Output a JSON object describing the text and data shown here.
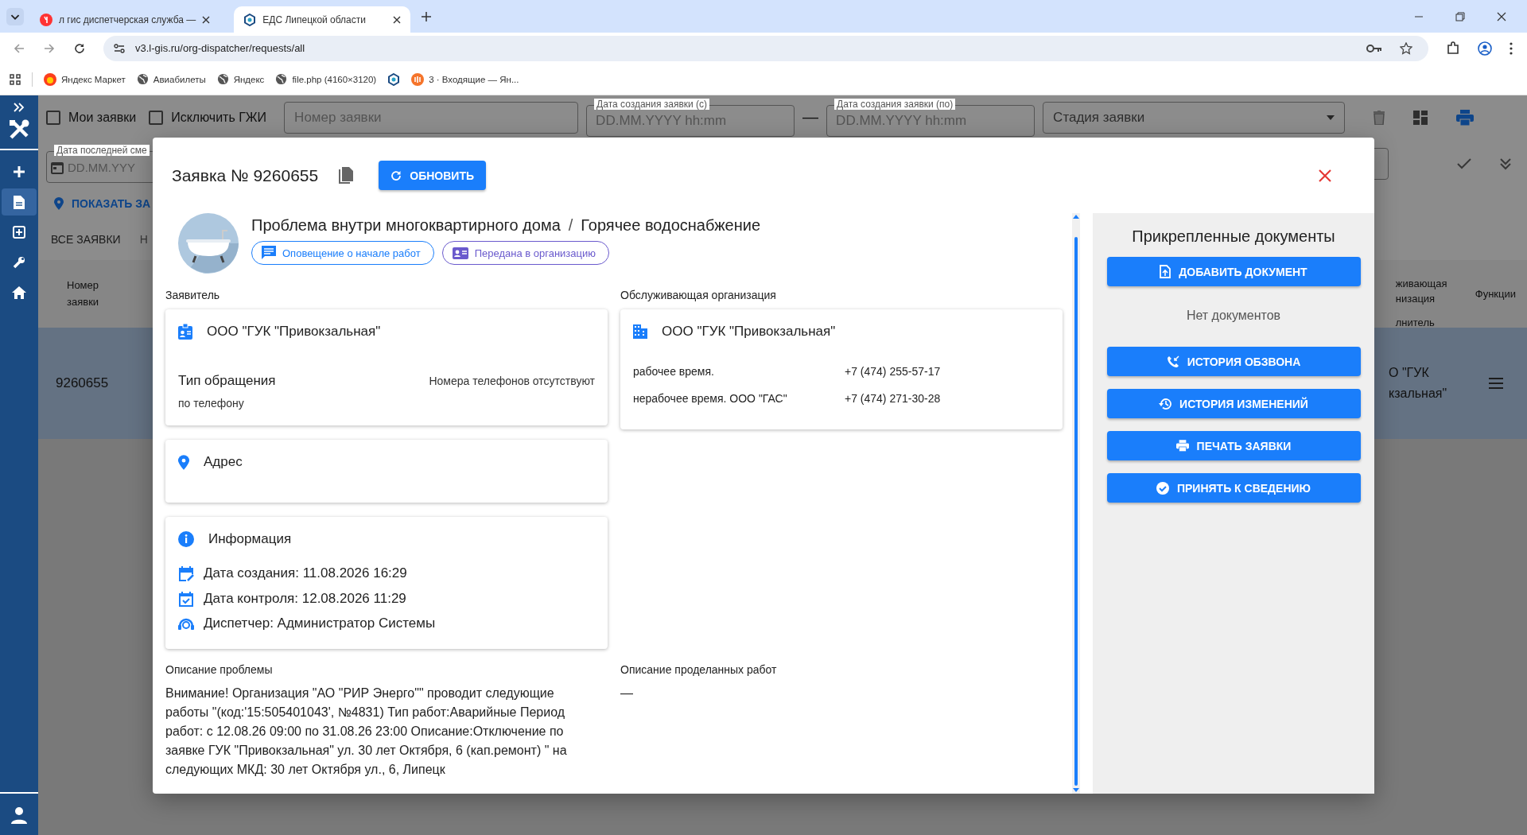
{
  "browser": {
    "tabs": [
      {
        "title": "л гис диспетчерская служба —",
        "selected": false,
        "kind": "yandex"
      },
      {
        "title": "ЕДС Липецкой области",
        "selected": true,
        "kind": "site"
      }
    ],
    "address": "v3.l-gis.ru/org-dispatcher/requests/all",
    "bookmarks": [
      {
        "label": "Яндекс Маркет",
        "kind": "market"
      },
      {
        "label": "Авиабилеты",
        "kind": "globe"
      },
      {
        "label": "Яндекс",
        "kind": "globe"
      },
      {
        "label": "file.php (4160×3120)",
        "kind": "globe"
      },
      {
        "kind": "site"
      },
      {
        "label": "3 · Входящие — Ян...",
        "kind": "mail"
      }
    ]
  },
  "sidebar": {
    "items": [
      {
        "kind": "add",
        "selected": false
      },
      {
        "kind": "document",
        "selected": true
      },
      {
        "kind": "add-box",
        "selected": false
      },
      {
        "kind": "wrench",
        "selected": false
      },
      {
        "kind": "home",
        "selected": false
      }
    ]
  },
  "filters": {
    "checkboxes": [
      {
        "label": "Мои заявки",
        "checked": false
      },
      {
        "label": "Исключить ГЖИ",
        "checked": false
      }
    ],
    "number_field": {
      "placeholder": "Номер заявки"
    },
    "date_from": {
      "label": "Дата создания заявки (с)",
      "placeholder": "DD.MM.YYYY hh:mm"
    },
    "dash": "—",
    "date_to": {
      "label": "Дата создания заявки (по)",
      "placeholder": "DD.MM.YYYY hh:mm"
    },
    "stage": {
      "placeholder": "Стадия заявки"
    },
    "last_change": {
      "label": "Дата последней сме",
      "placeholder": "DD.MM.YYY"
    },
    "map_link": "ПОКАЗАТЬ ЗА"
  },
  "list_tabs": [
    {
      "label": "ВСЕ ЗАЯВКИ",
      "selected": true
    },
    {
      "label": "Н",
      "selected": false
    }
  ],
  "table": {
    "columns": [
      "Номер заявки",
      "живающая низация",
      "Функции"
    ],
    "subcolumn": "лнитель",
    "rows": [
      {
        "number": "9260655",
        "org": "О \"ГУК кзальная\"",
        "selected": true
      }
    ]
  },
  "modal": {
    "title": "Заявка № 9260655",
    "refresh_button": "ОБНОВИТЬ",
    "category": "Проблема внутри многоквартирного дома",
    "separator": "/",
    "subcategory": "Горячее водоснабжение",
    "chips": [
      {
        "label": "Оповещение о начале работ",
        "color": "#1a7efb",
        "kind": "message"
      },
      {
        "label": "Передана в организацию",
        "color": "#6a5acd",
        "kind": "card"
      }
    ],
    "applicant_label": "Заявитель",
    "applicant": {
      "name": "ООО \"ГУК \"Привокзальная\"",
      "type_label": "Тип обращения",
      "type_value": "по телефону",
      "phones": "Номера телефонов отсутствуют"
    },
    "org_label": "Обслуживающая организация",
    "org": {
      "name": "ООО \"ГУК \"Привокзальная\"",
      "contacts": [
        {
          "label": "рабочее время.",
          "phone": "+7 (474) 255-57-17"
        },
        {
          "label": "нерабочее время. ООО \"ГАС\"",
          "phone": "+7 (474) 271-30-28"
        }
      ]
    },
    "address_title": "Адрес",
    "info_title": "Информация",
    "info": [
      {
        "text": "Дата создания: 11.08.2026 16:29",
        "kind": "created"
      },
      {
        "text": "Дата контроля: 12.08.2026 11:29",
        "kind": "control"
      },
      {
        "text": "Диспетчер: Администратор Системы",
        "kind": "dispatcher"
      }
    ],
    "problem_label": "Описание проблемы",
    "problem_text": "Внимание! Организация \"АО \"РИР Энерго\"\" проводит следующие работы \"(код:'15:505401043', №4831) Тип работ:Аварийные Период работ: с 12.08.26 09:00 по 31.08.26 23:00 Описание:Отключение по заявке ГУК \"Привокзальная\" ул. 30 лет Октября, 6 (кап.ремонт) \" на следующих МКД: 30 лет Октября ул., 6, Липецк",
    "work_label": "Описание проделанных работ",
    "work_text": "—",
    "docs": {
      "title": "Прикрепленные документы",
      "add_button": "ДОБАВИТЬ ДОКУМЕНТ",
      "empty": "Нет документов",
      "buttons": [
        {
          "label": "ИСТОРИЯ ОБЗВОНА",
          "kind": "phone"
        },
        {
          "label": "ИСТОРИЯ ИЗМЕНЕНИЙ",
          "kind": "history"
        },
        {
          "label": "ПЕЧАТЬ ЗАЯВКИ",
          "kind": "print"
        },
        {
          "label": "ПРИНЯТЬ К СВЕДЕНИЮ",
          "kind": "check"
        }
      ]
    }
  }
}
